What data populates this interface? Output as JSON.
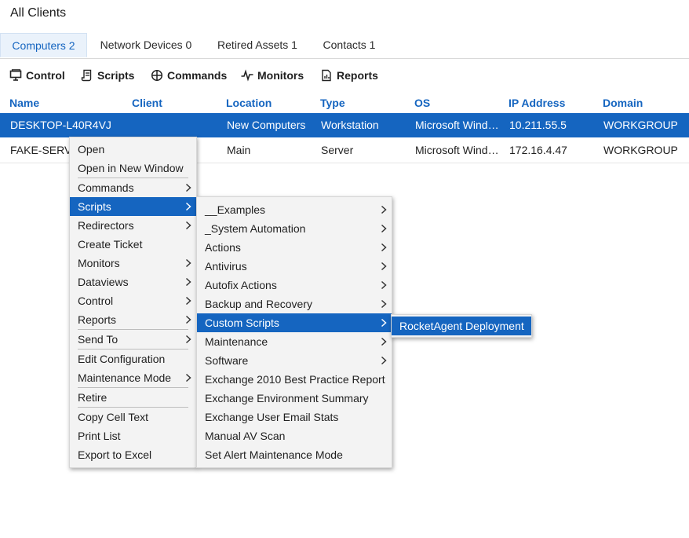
{
  "page_title": "All Clients",
  "tabs": [
    {
      "label": "Computers 2",
      "active": true
    },
    {
      "label": "Network Devices 0",
      "active": false
    },
    {
      "label": "Retired Assets 1",
      "active": false
    },
    {
      "label": "Contacts 1",
      "active": false
    }
  ],
  "toolbar": [
    {
      "label": "Control",
      "icon": "monitor-icon"
    },
    {
      "label": "Scripts",
      "icon": "script-icon"
    },
    {
      "label": "Commands",
      "icon": "crosshair-icon"
    },
    {
      "label": "Monitors",
      "icon": "pulse-icon"
    },
    {
      "label": "Reports",
      "icon": "report-icon"
    }
  ],
  "columns": [
    "Name",
    "Client",
    "Location",
    "Type",
    "OS",
    "IP Address",
    "Domain"
  ],
  "rows": [
    {
      "name": "DESKTOP-L40R4VJ",
      "client": "",
      "location": "New Computers",
      "type": "Workstation",
      "os": "Microsoft Wind…",
      "ip": "10.211.55.5",
      "domain": "WORKGROUP",
      "selected": true
    },
    {
      "name": "FAKE-SERV-",
      "client": "",
      "location": "Main",
      "type": "Server",
      "os": "Microsoft Wind…",
      "ip": "172.16.4.47",
      "domain": "WORKGROUP",
      "selected": false
    }
  ],
  "context_menu": [
    {
      "label": "Open",
      "submenu": false
    },
    {
      "label": "Open in New Window",
      "submenu": false
    },
    {
      "label": "Commands",
      "submenu": true
    },
    {
      "label": "Scripts",
      "submenu": true,
      "highlighted": true
    },
    {
      "label": "Redirectors",
      "submenu": true
    },
    {
      "label": "Create Ticket",
      "submenu": false
    },
    {
      "label": "Monitors",
      "submenu": true
    },
    {
      "label": "Dataviews",
      "submenu": true
    },
    {
      "label": "Control",
      "submenu": true
    },
    {
      "label": "Reports",
      "submenu": true
    },
    {
      "label": "Send To",
      "submenu": true
    },
    {
      "label": "Edit Configuration",
      "submenu": false
    },
    {
      "label": "Maintenance Mode",
      "submenu": true
    },
    {
      "label": "Retire",
      "submenu": false
    },
    {
      "label": "Copy Cell Text",
      "submenu": false
    },
    {
      "label": "Print List",
      "submenu": false
    },
    {
      "label": "Export to Excel",
      "submenu": false
    }
  ],
  "scripts_menu": [
    {
      "label": "__Examples",
      "submenu": true
    },
    {
      "label": "_System Automation",
      "submenu": true
    },
    {
      "label": "Actions",
      "submenu": true
    },
    {
      "label": "Antivirus",
      "submenu": true
    },
    {
      "label": "Autofix Actions",
      "submenu": true
    },
    {
      "label": "Backup and Recovery",
      "submenu": true
    },
    {
      "label": "Custom Scripts",
      "submenu": true,
      "highlighted": true
    },
    {
      "label": "Maintenance",
      "submenu": true
    },
    {
      "label": "Software",
      "submenu": true
    },
    {
      "label": "Exchange 2010 Best Practice Report",
      "submenu": false
    },
    {
      "label": "Exchange Environment Summary",
      "submenu": false
    },
    {
      "label": "Exchange User Email Stats",
      "submenu": false
    },
    {
      "label": "Manual AV Scan",
      "submenu": false
    },
    {
      "label": "Set Alert Maintenance Mode",
      "submenu": false
    }
  ],
  "custom_scripts_menu": [
    {
      "label": "RocketAgent Deployment",
      "highlighted": true
    }
  ],
  "colors": {
    "accent": "#1565c0",
    "menu_bg": "#f3f3f3",
    "tab_active_bg": "#eaf2fb"
  }
}
